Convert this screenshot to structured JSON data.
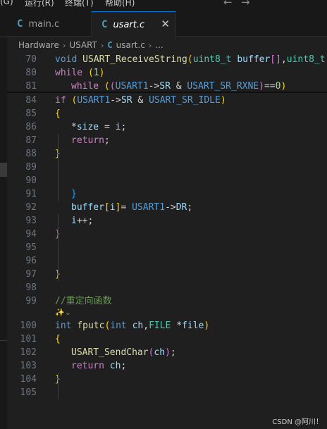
{
  "menubar": {
    "items": [
      "(G)",
      "运行(R)",
      "终端(T)",
      "帮助(H)"
    ],
    "back_arrow": "←",
    "forward_arrow": "→"
  },
  "tabs": [
    {
      "icon": "C",
      "label": "main.c",
      "active": false
    },
    {
      "icon": "C",
      "label": "usart.c",
      "active": true,
      "close": "✕"
    }
  ],
  "breadcrumb": [
    "Hardware",
    "USART",
    "usart.c",
    "..."
  ],
  "breadcrumb_sep": "›",
  "editor": {
    "lines": [
      {
        "n": "70",
        "segs": [
          [
            "kw",
            "void "
          ],
          [
            "fn",
            "USART_ReceiveString"
          ],
          [
            "p1",
            "("
          ],
          [
            "ty",
            "uint8_t "
          ],
          [
            "var",
            "buffer"
          ],
          [
            "p2",
            "[]"
          ],
          [
            "txt",
            ","
          ],
          [
            "ty",
            "uint8_t"
          ]
        ]
      },
      {
        "n": "80",
        "segs": [
          [
            "ctl",
            "while "
          ],
          [
            "p1",
            "("
          ],
          [
            "num",
            "1"
          ],
          [
            "p1",
            ")"
          ]
        ]
      },
      {
        "n": "81",
        "indent": 1,
        "segs": [
          [
            "ctl",
            "while "
          ],
          [
            "p1",
            "("
          ],
          [
            "p2",
            "("
          ],
          [
            "mac",
            "USART1"
          ],
          [
            "txt",
            "->"
          ],
          [
            "var",
            "SR"
          ],
          [
            "txt",
            " & "
          ],
          [
            "mac",
            "USART_SR_RXNE"
          ],
          [
            "p2",
            ")"
          ],
          [
            "txt",
            "=="
          ],
          [
            "num",
            "0"
          ],
          [
            "p1",
            ")"
          ]
        ]
      },
      {
        "n": "84",
        "segs": [
          [
            "ctl",
            "if "
          ],
          [
            "p1",
            "("
          ],
          [
            "mac",
            "USART1"
          ],
          [
            "txt",
            "->"
          ],
          [
            "var",
            "SR"
          ],
          [
            "txt",
            " & "
          ],
          [
            "mac",
            "USART_SR_IDLE"
          ],
          [
            "p1",
            ")"
          ]
        ]
      },
      {
        "n": "85",
        "segs": [
          [
            "p1",
            "{"
          ]
        ]
      },
      {
        "n": "86",
        "indent": 1,
        "segs": [
          [
            "txt",
            "*"
          ],
          [
            "var",
            "size"
          ],
          [
            "txt",
            " = "
          ],
          [
            "var",
            "i"
          ],
          [
            "txt",
            ";"
          ]
        ]
      },
      {
        "n": "87",
        "indent": 1,
        "segs": [
          [
            "ctl",
            "return"
          ],
          [
            "txt",
            ";"
          ]
        ]
      },
      {
        "n": "88",
        "segs": [
          [
            "p1",
            "}"
          ]
        ]
      },
      {
        "n": "89",
        "segs": []
      },
      {
        "n": "90",
        "segs": []
      },
      {
        "n": "91",
        "indent": 1,
        "segs": [
          [
            "p3",
            "}"
          ]
        ]
      },
      {
        "n": "92",
        "indent": 1,
        "segs": [
          [
            "var",
            "buffer"
          ],
          [
            "p1",
            "["
          ],
          [
            "var",
            "i"
          ],
          [
            "p1",
            "]"
          ],
          [
            "txt",
            "= "
          ],
          [
            "mac",
            "USART1"
          ],
          [
            "txt",
            "->"
          ],
          [
            "var",
            "DR"
          ],
          [
            "txt",
            ";"
          ]
        ]
      },
      {
        "n": "93",
        "indent": 1,
        "segs": [
          [
            "var",
            "i"
          ],
          [
            "txt",
            "++;"
          ]
        ]
      },
      {
        "n": "94",
        "segs": [
          [
            "p2",
            "}"
          ]
        ]
      },
      {
        "n": "95",
        "segs": []
      },
      {
        "n": "96",
        "segs": []
      },
      {
        "n": "97",
        "segs": [
          [
            "p1",
            "}"
          ]
        ]
      },
      {
        "n": "98",
        "segs": []
      },
      {
        "n": "99",
        "segs": [
          [
            "cmt",
            "//重定向函数"
          ]
        ]
      },
      {
        "n": "100",
        "segs": [
          [
            "kw",
            "int "
          ],
          [
            "fn",
            "fputc"
          ],
          [
            "p1",
            "("
          ],
          [
            "kw",
            "int "
          ],
          [
            "var",
            "ch"
          ],
          [
            "txt",
            ","
          ],
          [
            "ty",
            "FILE "
          ],
          [
            "txt",
            "*"
          ],
          [
            "var",
            "file"
          ],
          [
            "p1",
            ")"
          ]
        ]
      },
      {
        "n": "101",
        "segs": [
          [
            "p1",
            "{"
          ]
        ]
      },
      {
        "n": "102",
        "indent": 1,
        "segs": [
          [
            "fn",
            "USART_SendChar"
          ],
          [
            "p2",
            "("
          ],
          [
            "var",
            "ch"
          ],
          [
            "p2",
            ")"
          ],
          [
            "txt",
            ";"
          ]
        ]
      },
      {
        "n": "103",
        "indent": 1,
        "segs": [
          [
            "ctl",
            "return "
          ],
          [
            "var",
            "ch"
          ],
          [
            "txt",
            ";"
          ]
        ]
      },
      {
        "n": "104",
        "segs": [
          [
            "p1",
            "}"
          ]
        ]
      },
      {
        "n": "105",
        "segs": []
      }
    ],
    "codelens": "✨⌄"
  },
  "watermark": "CSDN @阿川！"
}
